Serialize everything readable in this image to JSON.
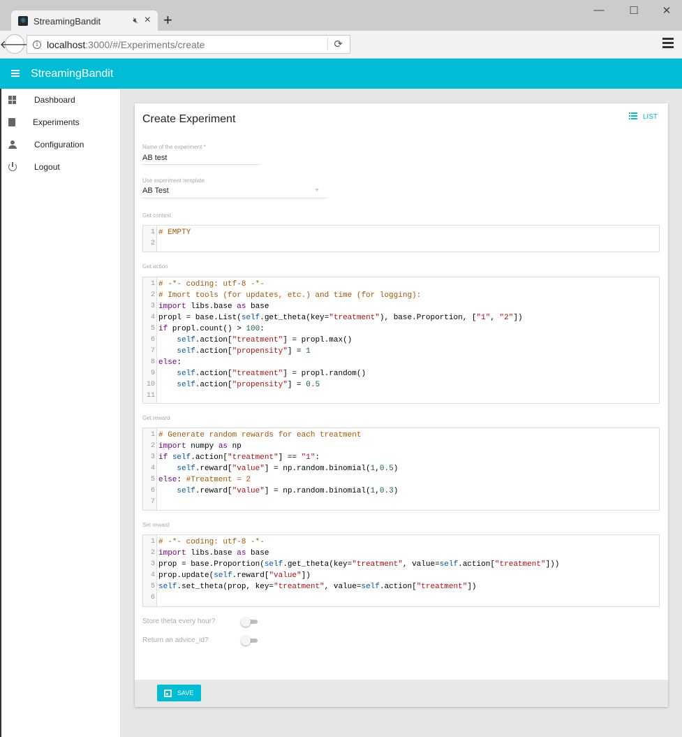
{
  "browser": {
    "tab_title": "StreamingBandit",
    "url_host": "localhost",
    "url_path": ":3000/#/Experiments/create",
    "newtab_glyph": "+",
    "minimize_glyph": "—",
    "maximize_glyph": "☐",
    "close_glyph": "✕"
  },
  "appbar": {
    "title": "StreamingBandit",
    "color": "#00bcd4"
  },
  "sidebar": {
    "items": [
      {
        "label": "Dashboard",
        "icon": "dashboard-icon"
      },
      {
        "label": "Experiments",
        "icon": "book-icon"
      },
      {
        "label": "Configuration",
        "icon": "person-icon"
      },
      {
        "label": "Logout",
        "icon": "power-icon"
      }
    ]
  },
  "card": {
    "title": "Create Experiment",
    "list_label": "LIST",
    "name_label": "Name of the experiment *",
    "name_value": "AB test",
    "template_label": "Use experiment template",
    "template_value": "AB Test",
    "get_context_label": "Get context",
    "get_action_label": "Get action",
    "get_reward_label": "Get reward",
    "set_reward_label": "Set reward",
    "store_theta_label": "Store theta every hour?",
    "advice_id_label": "Return an advice_id?",
    "store_theta_on": false,
    "advice_id_on": false,
    "save_label": "SAVE"
  },
  "code": {
    "get_context": [
      "# EMPTY",
      ""
    ],
    "get_action": [
      "# -*- coding: utf-8 -*-",
      "# Imort tools (for updates, etc.) and time (for logging):",
      "import libs.base as base",
      "propl = base.List(self.get_theta(key=\"treatment\"), base.Proportion, [\"1\", \"2\"])",
      "if propl.count() > 100:",
      "    self.action[\"treatment\"] = propl.max()",
      "    self.action[\"propensity\"] = 1",
      "else:",
      "    self.action[\"treatment\"] = propl.random()",
      "    self.action[\"propensity\"] = 0.5",
      ""
    ],
    "get_reward": [
      "# Generate random rewards for each treatment",
      "import numpy as np",
      "if self.action[\"treatment\"] == \"1\":",
      "    self.reward[\"value\"] = np.random.binomial(1,0.5)",
      "else: #Treatment = 2",
      "    self.reward[\"value\"] = np.random.binomial(1,0.3)",
      ""
    ],
    "set_reward": [
      "# -*- coding: utf-8 -*-",
      "import libs.base as base",
      "prop = base.Proportion(self.get_theta(key=\"treatment\", value=self.action[\"treatment\"]))",
      "prop.update(self.reward[\"value\"])",
      "self.set_theta(prop, key=\"treatment\", value=self.action[\"treatment\"])",
      ""
    ]
  }
}
